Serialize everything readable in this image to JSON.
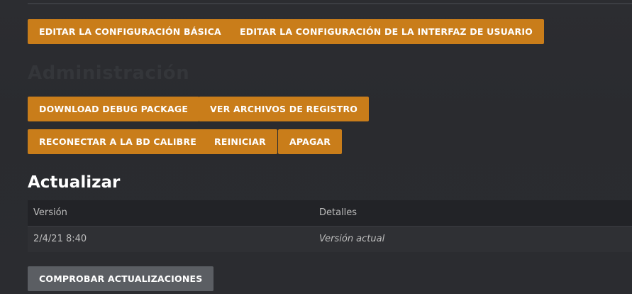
{
  "config": {
    "basic_label": "EDITAR LA CONFIGURACIÓN BÁSICA",
    "ui_label": "EDITAR LA CONFIGURACIÓN DE LA INTERFAZ DE USUARIO"
  },
  "admin": {
    "heading": "Administración",
    "download_debug_label": "DOWNLOAD DEBUG PACKAGE",
    "view_logs_label": "VER ARCHIVOS DE REGISTRO",
    "reconnect_label": "RECONECTAR A LA BD CALIBRE",
    "restart_label": "REINICIAR",
    "shutdown_label": "APAGAR"
  },
  "update": {
    "heading": "Actualizar",
    "table": {
      "headers": [
        "Versión",
        "Detalles"
      ],
      "rows": [
        [
          "2/4/21 8:40",
          "Versión actual"
        ]
      ]
    },
    "check_label": "COMPROBAR ACTUALIZACIONES"
  },
  "colors": {
    "accent": "#c97d1a",
    "secondary_button": "#5b5e63",
    "background": "#2b2c30"
  }
}
